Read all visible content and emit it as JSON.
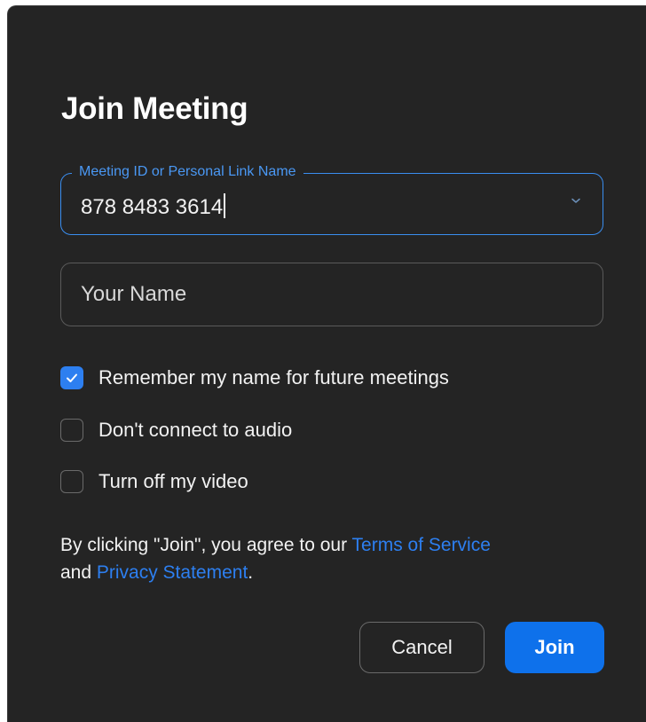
{
  "dialog": {
    "title": "Join Meeting"
  },
  "meeting_field": {
    "label": "Meeting ID or Personal Link Name",
    "value": "878 8483 3614",
    "chevron_icon": "chevron-down-icon"
  },
  "name_field": {
    "placeholder": "Your Name",
    "value": ""
  },
  "options": [
    {
      "label": "Remember my name for future meetings",
      "checked": true
    },
    {
      "label": "Don't connect to audio",
      "checked": false
    },
    {
      "label": "Turn off my video",
      "checked": false
    }
  ],
  "terms": {
    "prefix": "By clicking \"Join\", you agree to our ",
    "tos_link": "Terms of Service",
    "middle": " and ",
    "privacy_link": "Privacy Statement",
    "suffix": "."
  },
  "buttons": {
    "cancel": "Cancel",
    "join": "Join"
  },
  "colors": {
    "background": "#242424",
    "accent": "#2d7ff0",
    "join_button": "#0e71eb",
    "text": "#f2f2f2"
  }
}
